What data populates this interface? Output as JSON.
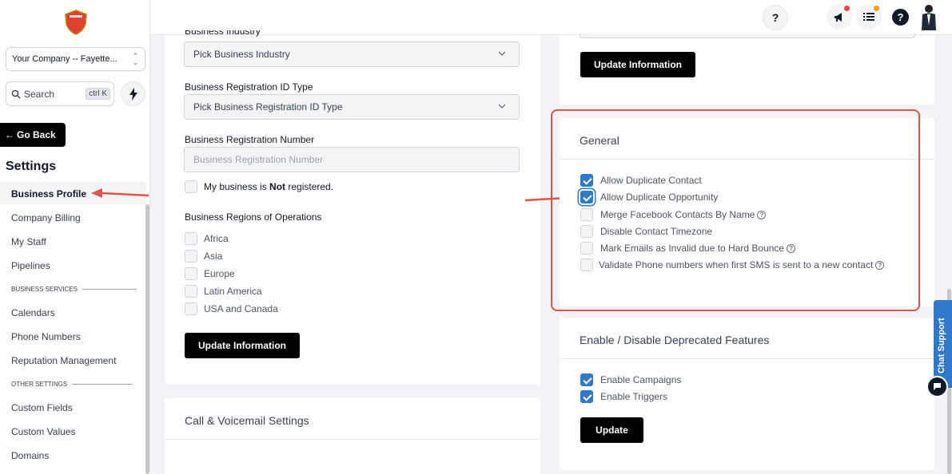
{
  "sidebar": {
    "company": "Your Company -- Fayette...",
    "search_placeholder": "Search",
    "search_shortcut": "ctrl K",
    "go_back": "Go Back",
    "settings_title": "Settings",
    "items": [
      {
        "label": "Business Profile"
      },
      {
        "label": "Company Billing"
      },
      {
        "label": "My Staff"
      },
      {
        "label": "Pipelines"
      },
      {
        "label": "Calendars"
      },
      {
        "label": "Phone Numbers"
      },
      {
        "label": "Reputation Management"
      },
      {
        "label": "Custom Fields"
      },
      {
        "label": "Custom Values"
      },
      {
        "label": "Domains"
      }
    ],
    "sections": {
      "business_services": "BUSINESS SERVICES",
      "other_settings": "OTHER SETTINGS"
    }
  },
  "left_card": {
    "business_industry_label": "Business Industry",
    "business_industry_value": "Pick Business Industry",
    "reg_id_type_label": "Business Registration ID Type",
    "reg_id_type_value": "Pick Business Registration ID Type",
    "reg_number_label": "Business Registration Number",
    "reg_number_placeholder": "Business Registration Number",
    "not_registered_pre": "My business is ",
    "not_registered_bold": "Not",
    "not_registered_post": " registered.",
    "regions_label": "Business Regions of Operations",
    "regions": [
      "Africa",
      "Asia",
      "Europe",
      "Latin America",
      "USA and Canada"
    ],
    "update_button": "Update Information"
  },
  "call_card": {
    "title": "Call & Voicemail Settings"
  },
  "right_top_card": {
    "update_button": "Update Information"
  },
  "general_card": {
    "title": "General",
    "options": [
      {
        "label": "Allow Duplicate Contact",
        "checked": true
      },
      {
        "label": "Allow Duplicate Opportunity",
        "checked": true
      },
      {
        "label": "Merge Facebook Contacts By Name",
        "checked": false
      },
      {
        "label": "Disable Contact Timezone",
        "checked": false
      },
      {
        "label": "Mark Emails as Invalid due to Hard Bounce",
        "checked": false
      },
      {
        "label": "Validate Phone numbers when first SMS is sent to a new contact",
        "checked": false
      }
    ]
  },
  "deprecated_card": {
    "title": "Enable / Disable Deprecated Features",
    "options": [
      {
        "label": "Enable Campaigns",
        "checked": true
      },
      {
        "label": "Enable Triggers",
        "checked": true
      }
    ],
    "update_button": "Update"
  },
  "chat_support": "Chat Support",
  "colors": {
    "accent_blue": "#2f79c8",
    "highlight_red": "#e0554a"
  }
}
